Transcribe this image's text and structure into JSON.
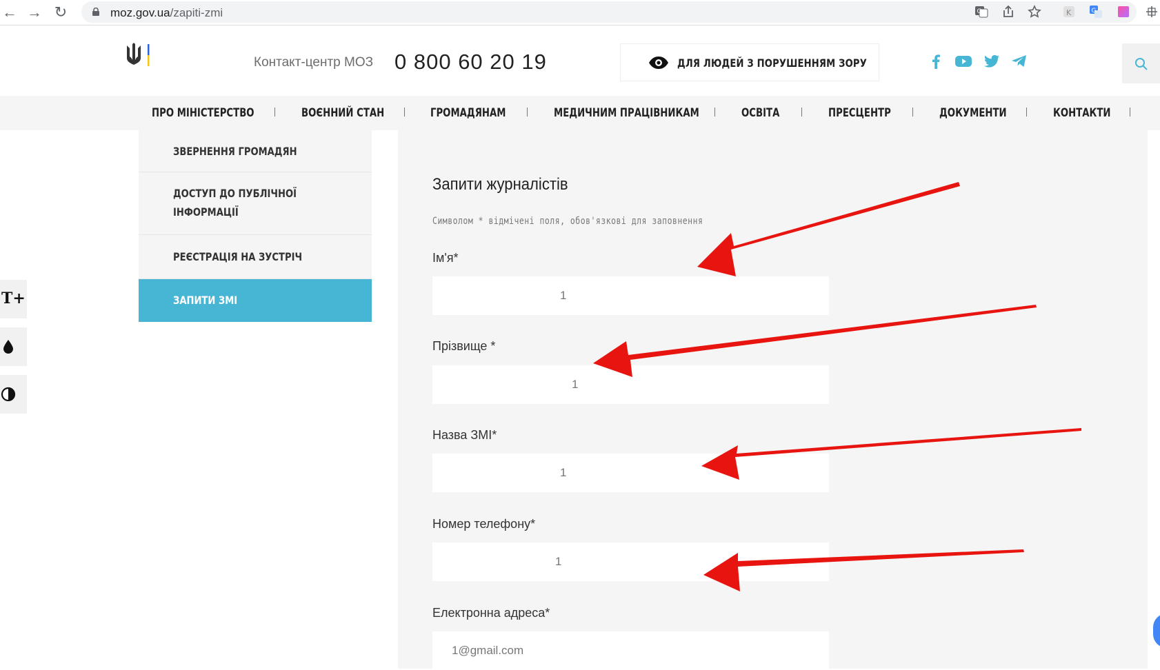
{
  "browser": {
    "url_host": "moz.gov.ua",
    "url_path": "/zapiti-zmi"
  },
  "header": {
    "contact_label": "Контакт-центр МОЗ",
    "phone": "0 800 60 20 19",
    "vision_button": "ДЛЯ ЛЮДЕЙ З ПОРУШЕННЯМ ЗОРУ"
  },
  "nav": {
    "items": [
      {
        "label": "ПРО МІНІСТЕРСТВО"
      },
      {
        "label": "ВОЄННИЙ СТАН"
      },
      {
        "label": "ГРОМАДЯНАМ"
      },
      {
        "label": "МЕДИЧНИМ ПРАЦІВНИКАМ"
      },
      {
        "label": "ОСВІТА"
      },
      {
        "label": "ПРЕСЦЕНТР"
      },
      {
        "label": "ДОКУМЕНТИ"
      },
      {
        "label": "КОНТАКТИ"
      }
    ]
  },
  "sidebar": {
    "items": [
      {
        "label": "ЗВЕРНЕННЯ ГРОМАДЯН"
      },
      {
        "label": "ДОСТУП ДО ПУБЛІЧНОЇ\nІНФОРМАЦІЇ"
      },
      {
        "label": "РЕЄСТРАЦІЯ НА ЗУСТРІЧ"
      },
      {
        "label": "ЗАПИТИ ЗМІ"
      }
    ],
    "active_index": 3
  },
  "a11y": {
    "font_button": "T+"
  },
  "form": {
    "title": "Запити журналістів",
    "note": "Символом * відмічені поля, обов'язкові для заповнення",
    "fields": [
      {
        "label": "Ім'я*",
        "value": "1"
      },
      {
        "label": "Прізвище *",
        "value": "1"
      },
      {
        "label": "Назва ЗМІ*",
        "value": "1"
      },
      {
        "label": "Номер телефону*",
        "value": "1"
      },
      {
        "label": "Електронна адреса*",
        "value": "1@gmail.com"
      }
    ]
  },
  "colors": {
    "accent": "#47b6d5",
    "social": "#47b6d5",
    "arrow": "#e8140f"
  }
}
